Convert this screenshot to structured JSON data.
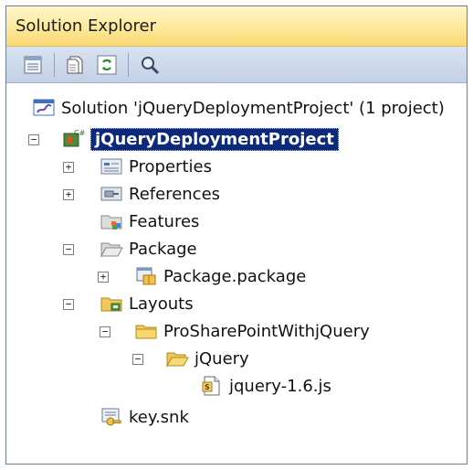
{
  "panel": {
    "title": "Solution Explorer"
  },
  "toolbar": {
    "buttons": [
      {
        "name": "properties-icon"
      },
      {
        "name": "show-all-files-icon"
      },
      {
        "name": "refresh-icon"
      },
      {
        "name": "view-class-diagram-icon"
      }
    ]
  },
  "tree": {
    "solution": "Solution 'jQueryDeploymentProject' (1 project)",
    "project": "jQueryDeploymentProject",
    "properties": "Properties",
    "references": "References",
    "features": "Features",
    "package": "Package",
    "package_file": "Package.package",
    "layouts": "Layouts",
    "layouts_folder": "ProSharePointWithjQuery",
    "jquery_folder": "jQuery",
    "jquery_file": "jquery-1.6.js",
    "key_file": "key.snk"
  },
  "expanders": {
    "plus": "+",
    "minus": "−"
  },
  "colors": {
    "titlebar": "#fde89a",
    "toolbar": "#c9d6ea",
    "selection": "#0d2a7a"
  }
}
